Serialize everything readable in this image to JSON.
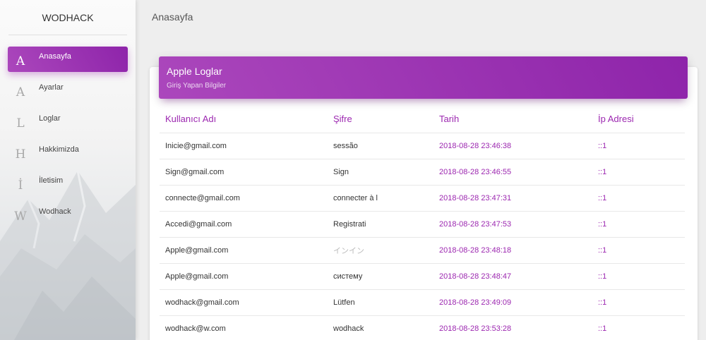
{
  "brand": "WODHACK",
  "page_title": "Anasayfa",
  "nav": [
    {
      "letter": "A",
      "label": "Anasayfa",
      "active": true
    },
    {
      "letter": "A",
      "label": "Ayarlar"
    },
    {
      "letter": "L",
      "label": "Loglar"
    },
    {
      "letter": "H",
      "label": "Hakkimizda"
    },
    {
      "letter": "İ",
      "label": "İletisim"
    },
    {
      "letter": "W",
      "label": "Wodhack"
    }
  ],
  "card": {
    "title": "Apple Loglar",
    "subtitle": "Giriş Yapan Bilgiler"
  },
  "table": {
    "headers": [
      "Kullanıcı Adı",
      "Şifre",
      "Tarih",
      "İp Adresi"
    ],
    "rows": [
      {
        "user": "Inicie@gmail.com",
        "password": "sessão",
        "date": "2018-08-28 23:46:38",
        "ip": "::1"
      },
      {
        "user": "Sign@gmail.com",
        "password": "Sign",
        "date": "2018-08-28 23:46:55",
        "ip": "::1"
      },
      {
        "user": "connecte@gmail.com",
        "password": "connecter à l",
        "date": "2018-08-28 23:47:31",
        "ip": "::1"
      },
      {
        "user": "Accedi@gmail.com",
        "password": "Registrati",
        "date": "2018-08-28 23:47:53",
        "ip": "::1"
      },
      {
        "user": "Apple@gmail.com",
        "password": "インイン",
        "date": "2018-08-28 23:48:18",
        "ip": "::1"
      },
      {
        "user": "Apple@gmail.com",
        "password": "систему",
        "date": "2018-08-28 23:48:47",
        "ip": "::1"
      },
      {
        "user": "wodhack@gmail.com",
        "password": "Lütfen",
        "date": "2018-08-28 23:49:09",
        "ip": "::1"
      },
      {
        "user": "wodhack@w.com",
        "password": "wodhack",
        "date": "2018-08-28 23:53:28",
        "ip": "::1"
      }
    ]
  },
  "colors": {
    "accent": "#9c27b0",
    "accent_gradient_start": "#ab47bc",
    "accent_gradient_end": "#8e24aa"
  }
}
